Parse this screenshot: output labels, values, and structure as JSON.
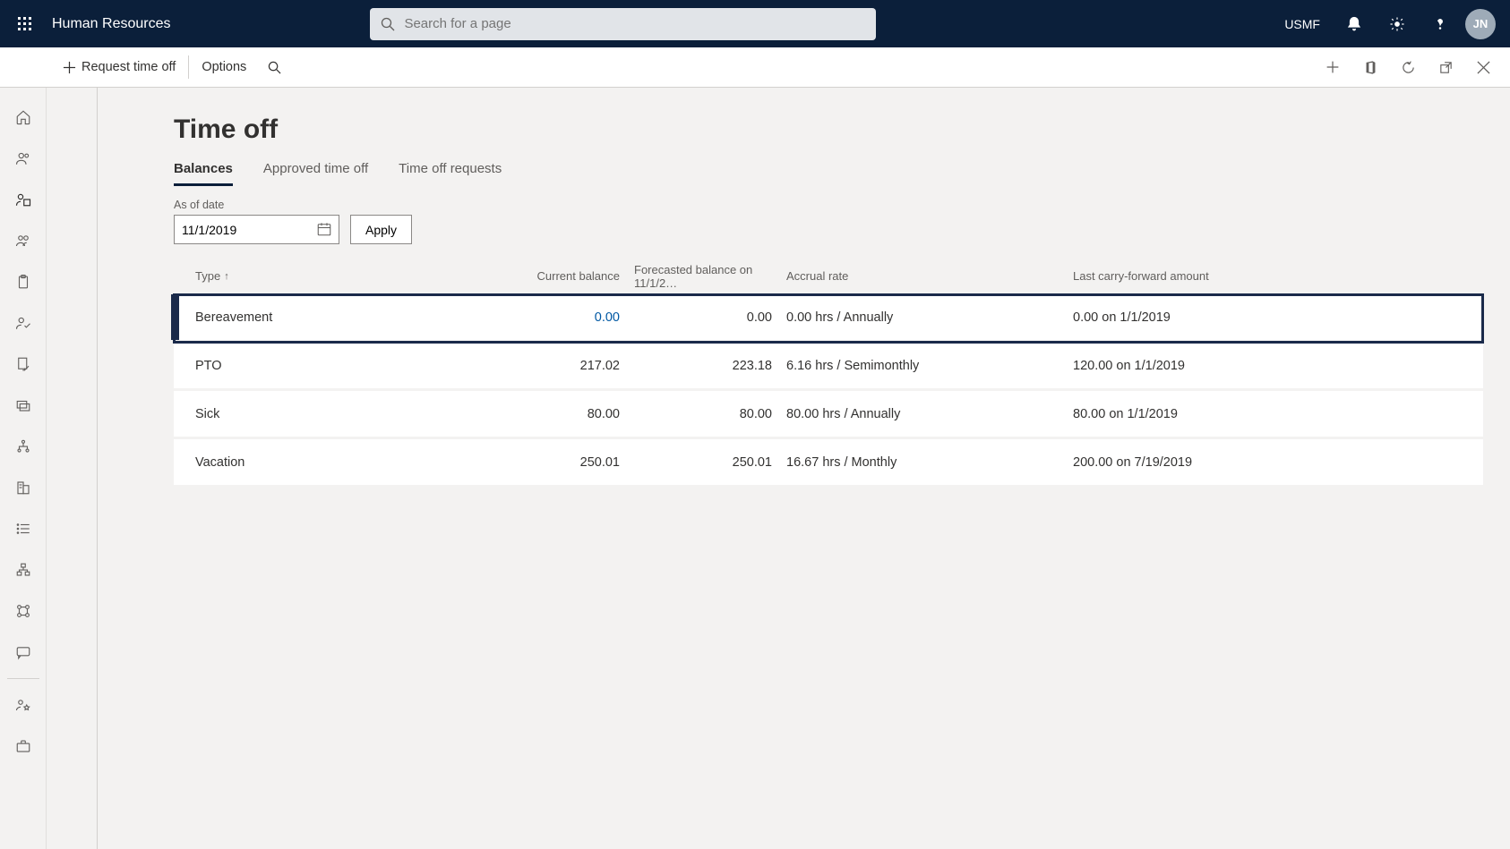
{
  "app": {
    "title": "Human Resources",
    "search_placeholder": "Search for a page",
    "entity": "USMF",
    "avatar": "JN"
  },
  "actions": {
    "request_time_off": "Request time off",
    "options": "Options"
  },
  "page": {
    "title": "Time off",
    "tabs": [
      {
        "label": "Balances",
        "active": true
      },
      {
        "label": "Approved time off",
        "active": false
      },
      {
        "label": "Time off requests",
        "active": false
      }
    ],
    "asof_label": "As of date",
    "asof_value": "11/1/2019",
    "apply_label": "Apply",
    "columns": {
      "type": "Type",
      "current": "Current balance",
      "forecast": "Forecasted balance on 11/1/2…",
      "accrual": "Accrual rate",
      "carry": "Last carry-forward amount"
    },
    "rows": [
      {
        "type": "Bereavement",
        "current": "0.00",
        "forecast": "0.00",
        "accrual": "0.00 hrs / Annually",
        "carry": "0.00 on 1/1/2019",
        "selected": true,
        "link": true
      },
      {
        "type": "PTO",
        "current": "217.02",
        "forecast": "223.18",
        "accrual": "6.16 hrs / Semimonthly",
        "carry": "120.00 on 1/1/2019"
      },
      {
        "type": "Sick",
        "current": "80.00",
        "forecast": "80.00",
        "accrual": "80.00 hrs / Annually",
        "carry": "80.00 on 1/1/2019"
      },
      {
        "type": "Vacation",
        "current": "250.01",
        "forecast": "250.01",
        "accrual": "16.67 hrs / Monthly",
        "carry": "200.00 on 7/19/2019"
      }
    ]
  }
}
